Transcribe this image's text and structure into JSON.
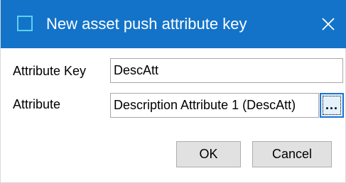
{
  "window": {
    "title": "New asset push attribute key",
    "close_glyph": "✕",
    "titlebar_color": "#1373c9",
    "icon": "window-icon",
    "close_icon": "close-icon"
  },
  "form": {
    "attribute_key": {
      "label": "Attribute Key",
      "value": "DescAtt"
    },
    "attribute": {
      "label": "Attribute",
      "value": "Description Attribute 1 (DescAtt)",
      "browse_label": "..."
    }
  },
  "buttons": {
    "ok_label": "OK",
    "cancel_label": "Cancel"
  }
}
